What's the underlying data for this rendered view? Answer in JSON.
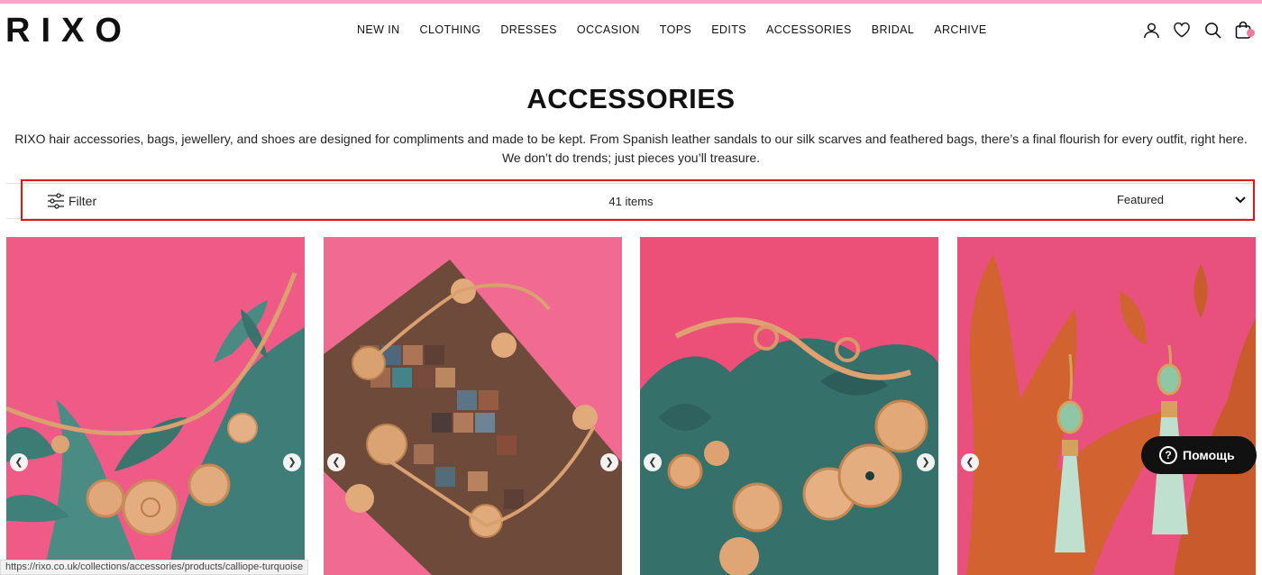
{
  "brand": {
    "logo_text": "RIXO",
    "stripe_color": "#f4a6c6"
  },
  "nav": {
    "items": [
      {
        "label": "NEW IN"
      },
      {
        "label": "CLOTHING"
      },
      {
        "label": "DRESSES"
      },
      {
        "label": "OCCASION"
      },
      {
        "label": "TOPS"
      },
      {
        "label": "EDITS"
      },
      {
        "label": "ACCESSORIES"
      },
      {
        "label": "BRIDAL"
      },
      {
        "label": "ARCHIVE"
      }
    ],
    "icons": [
      "account-icon",
      "wishlist-heart-icon",
      "search-icon",
      "shopping-bag-icon"
    ]
  },
  "collection": {
    "title": "ACCESSORIES",
    "description": "RIXO hair accessories, bags, jewellery, and shoes are designed for compliments and made to be kept. From Spanish leather sandals to our silk scarves and feathered bags, there’s a final flourish for every outfit, right here. We don’t do trends; just pieces you’ll treasure."
  },
  "toolbar": {
    "filter_label": "Filter",
    "items_count": "41 items",
    "sort_selected": "Featured",
    "highlight_color": "#e31414"
  },
  "products": [
    {
      "image": "gold coin charm necklace on teal coral",
      "bg": "#f05a86"
    },
    {
      "image": "gold coin charm necklace on mosaic stone box",
      "bg": "#f06a92"
    },
    {
      "image": "gold coin charm bracelet on teal coral",
      "bg": "#ec4f78"
    },
    {
      "image": "jade drop earrings on orange coral",
      "bg": "#e8507e"
    }
  ],
  "help": {
    "label": "Помощь"
  },
  "status_bar": {
    "url": "https://rixo.co.uk/collections/accessories/products/calliope-turquoise"
  }
}
